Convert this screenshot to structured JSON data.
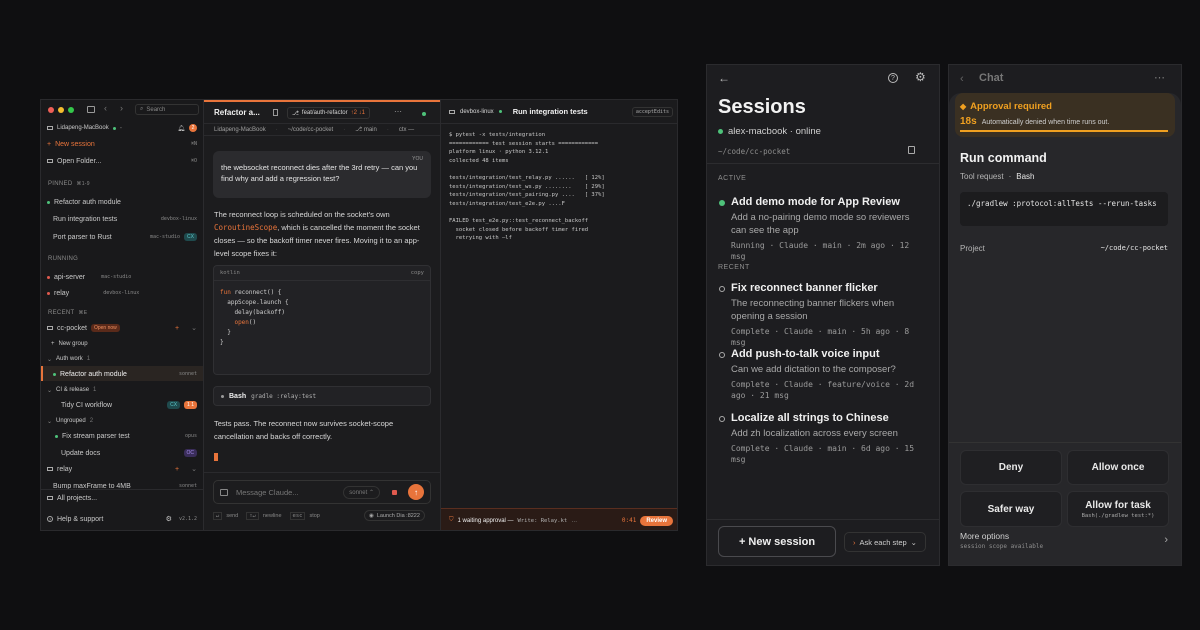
{
  "desktop": {
    "sidebar": {
      "search_placeholder": "Search",
      "notif_count": "2",
      "machine": "Lidapeng-MacBook",
      "machine_suffix": "-",
      "new_session": "New session",
      "new_session_kbd": "⌘N",
      "open_folder": "Open Folder...",
      "open_folder_kbd": "⌘O",
      "pinned_label": "PINNED",
      "pinned_kbd": "⌘1-9",
      "pinned": [
        {
          "label": "Refactor auth module",
          "tag": ""
        },
        {
          "label": "Run integration tests",
          "tag": "devbox-linux"
        },
        {
          "label": "Port parser to Rust",
          "tag": "mac-studio",
          "badge": "CX"
        }
      ],
      "running_label": "RUNNING",
      "running": [
        {
          "label": "api-server",
          "tag": "mac-studio"
        },
        {
          "label": "relay",
          "tag": "devbox-linux"
        }
      ],
      "recent_label": "RECENT",
      "recent_kbd": "⌘E",
      "project": "cc-pocket",
      "project_badge": "Open now",
      "new_group": "New group",
      "groups": [
        {
          "name": "Auth work",
          "count": "1"
        },
        {
          "name": "CI & release",
          "count": "1"
        },
        {
          "name": "Ungrouped",
          "count": "2"
        }
      ],
      "items": {
        "auth_item": "Refactor auth module",
        "auth_tag": "sonnet",
        "ci_item": "Tidy CI workflow",
        "ci_badge1": "CX",
        "ci_badge2": "1 1",
        "parse_item": "Fix stream parser test",
        "parse_tag": "opus",
        "docs_item": "Update docs",
        "docs_badge": "OC"
      },
      "relay_project": "relay",
      "relay_item": "Bump maxFrame to 4MB",
      "relay_tag": "sonnet",
      "all_projects": "All projects...",
      "help": "Help & support",
      "version": "v2.1.2"
    },
    "chat": {
      "title": "Refactor a...",
      "branch": "feat/auth-refactor",
      "branch_stats": "↑2 ↓1",
      "subbar_machine": "Lidapeng-MacBook",
      "subbar_path": "~/code/cc-pocket",
      "subbar_branch": "main",
      "subbar_ctx": "ctx —",
      "you_label": "YOU",
      "user_msg": "the websocket reconnect dies after the 3rd retry — can you find why and add a regression test?",
      "reply_1a": "The reconnect loop is scheduled on the socket's own ",
      "reply_1code": "CoroutineScope",
      "reply_1b": ", which is cancelled the moment the socket closes — so the backoff timer never fires. Moving it to an app-level scope fixes it:",
      "code_lang": "kotlin",
      "code_copy": "copy",
      "code_lines": [
        "fun reconnect() {",
        "  appScope.launch {",
        "    delay(backoff)",
        "    open()",
        "  }",
        "}"
      ],
      "tool_name": "Bash",
      "tool_cmd": "gradle :relay:test",
      "reply_2": "Tests pass. The reconnect now survives socket-scope cancellation and backs off correctly.",
      "input_placeholder": "Message Claude...",
      "model": "sonnet",
      "hints": {
        "send_key": "↵",
        "send": "send",
        "newline_key": "⇧↵",
        "newline": "newline",
        "stop_key": "esc",
        "stop": "stop"
      },
      "launch": "Launch Dia :8222"
    },
    "terminal": {
      "machine": "devbox-linux",
      "title": "Run integration tests",
      "mode": "acceptEdits",
      "lines": [
        "$ pytest -x tests/integration",
        "============ test session starts ============",
        "platform linux · python 3.12.1",
        "collected 48 items",
        "",
        "tests/integration/test_relay.py ......   [ 12%]",
        "tests/integration/test_ws.py ........    [ 29%]",
        "tests/integration/test_pairing.py ....   [ 37%]",
        "tests/integration/test_e2e.py ....F",
        "",
        "FAILED test_e2e.py::test_reconnect_backoff",
        "  socket closed before backoff timer fired",
        "  retrying with —lf"
      ],
      "status": "1 waiting approval —",
      "status_detail": "Write: Relay.kt",
      "status_more": "…",
      "time": "0:41",
      "review": "Review"
    }
  },
  "phone1": {
    "title": "Sessions",
    "host": "alex-macbook · online",
    "path": "~/code/cc-pocket",
    "active_label": "ACTIVE",
    "active": {
      "title": "Add demo mode for App Review",
      "desc": "Add a no-pairing demo mode so reviewers can see the app",
      "meta": "Running · Claude · main · 2m ago · 12 msg"
    },
    "recent_label": "RECENT",
    "recent": [
      {
        "title": "Fix reconnect banner flicker",
        "desc": "The reconnecting banner flickers when opening a session",
        "meta": "Complete · Claude · main · 5h ago · 8 msg"
      },
      {
        "title": "Add push-to-talk voice input",
        "desc": "Can we add dictation to the composer?",
        "meta": "Complete · Claude · feature/voice · 2d ago · 21 msg"
      },
      {
        "title": "Localize all strings to Chinese",
        "desc": "Add zh localization across every screen",
        "meta": "Complete · Claude · main · 6d ago · 15 msg"
      }
    ],
    "new_session": "+ New session",
    "ask_mode": "Ask each step"
  },
  "phone2": {
    "title": "Chat",
    "approval_title": "Approval required",
    "countdown": "18s",
    "countdown_note": "Automatically denied when time runs out.",
    "countdown_progress": 1.0,
    "command_title": "Run command",
    "tool_request": "Tool request",
    "tool": "Bash",
    "command": "./gradlew :protocol:allTests --rerun-tasks",
    "project_label": "Project",
    "project_value": "~/code/cc-pocket",
    "deny": "Deny",
    "allow_once": "Allow once",
    "safer": "Safer way",
    "allow_task": "Allow for task",
    "allow_task_sub": "Bash(./gradlew test:*)",
    "more": "More options",
    "more_sub": "session scope available"
  },
  "colors": {
    "accent": "#e8743b",
    "green": "#4ec27a",
    "red": "#e05a4e",
    "warning": "#f0a020"
  }
}
